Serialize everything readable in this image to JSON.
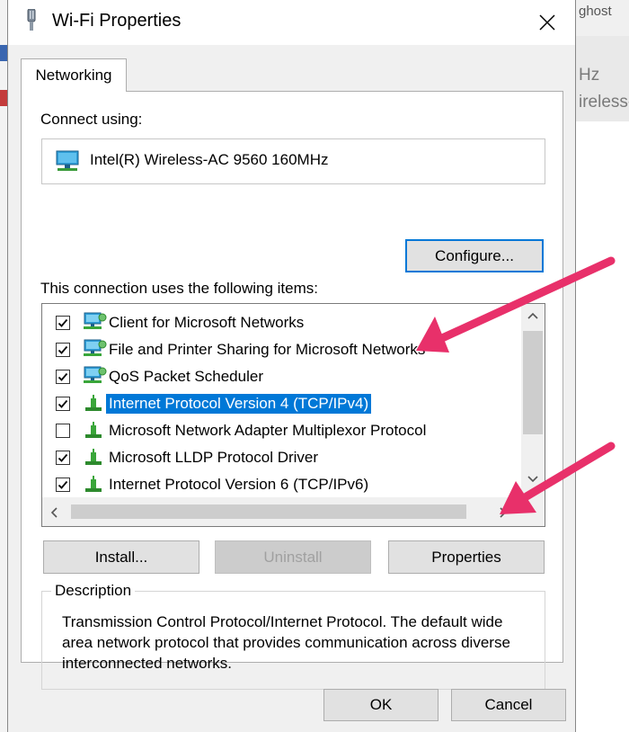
{
  "background_window": {
    "top_text": "ghost",
    "line1": "Hz",
    "line2": "ireless-A"
  },
  "dialog": {
    "title": "Wi-Fi Properties",
    "tabs": [
      {
        "label": "Networking"
      }
    ],
    "connect_using_label": "Connect using:",
    "adapter_name": "Intel(R) Wireless-AC 9560 160MHz",
    "configure_label": "Configure...",
    "items_label": "This connection uses the following items:",
    "items": [
      {
        "label": "Client for Microsoft Networks",
        "checked": true,
        "icon": "network-client-icon"
      },
      {
        "label": "File and Printer Sharing for Microsoft Networks",
        "checked": true,
        "icon": "network-service-icon"
      },
      {
        "label": "QoS Packet Scheduler",
        "checked": true,
        "icon": "network-service-icon"
      },
      {
        "label": "Internet Protocol Version 4 (TCP/IPv4)",
        "checked": true,
        "selected": true,
        "icon": "protocol-icon"
      },
      {
        "label": "Microsoft Network Adapter Multiplexor Protocol",
        "checked": false,
        "icon": "protocol-icon"
      },
      {
        "label": "Microsoft LLDP Protocol Driver",
        "checked": true,
        "icon": "protocol-icon"
      },
      {
        "label": "Internet Protocol Version 6 (TCP/IPv6)",
        "checked": true,
        "icon": "protocol-icon"
      }
    ],
    "install_label": "Install...",
    "uninstall_label": "Uninstall",
    "properties_label": "Properties",
    "description_legend": "Description",
    "description_text": "Transmission Control Protocol/Internet Protocol. The default wide area network protocol that provides communication across diverse interconnected networks.",
    "ok_label": "OK",
    "cancel_label": "Cancel"
  },
  "colors": {
    "selection": "#0078d7",
    "annotation_arrow": "#e8306a"
  }
}
